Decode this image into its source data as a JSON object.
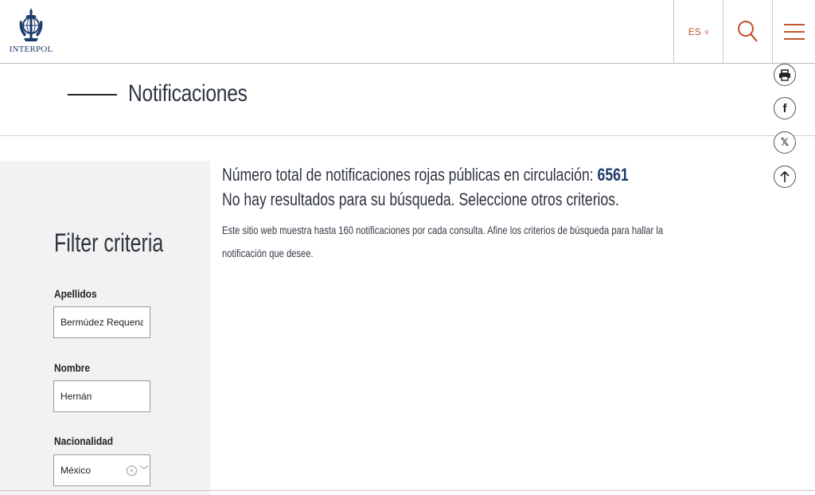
{
  "header": {
    "logo_text": "INTERPOL",
    "language": "ES",
    "accent_color": "#c0562b",
    "brand_color": "#1d3a6b"
  },
  "page": {
    "title": "Notificaciones"
  },
  "sidebar": {
    "title": "Filter criteria",
    "fields": {
      "surname_label": "Apellidos",
      "surname_value": "Bermúdez Requena",
      "name_label": "Nombre",
      "name_value": "Hernán",
      "nationality_label": "Nacionalidad",
      "nationality_value": "México"
    }
  },
  "results": {
    "total_prefix": "Número total de notificaciones rojas públicas en circulación:",
    "total_count": "6561",
    "no_results": "No hay resultados para su búsqueda. Seleccione otros criterios.",
    "note": "Este sitio web muestra hasta 160 notificaciones por cada consulta. Afine los criterios de búsqueda para hallar la notificación que desee."
  },
  "share": {
    "facebook_glyph": "f",
    "x_glyph": "𝕏"
  }
}
